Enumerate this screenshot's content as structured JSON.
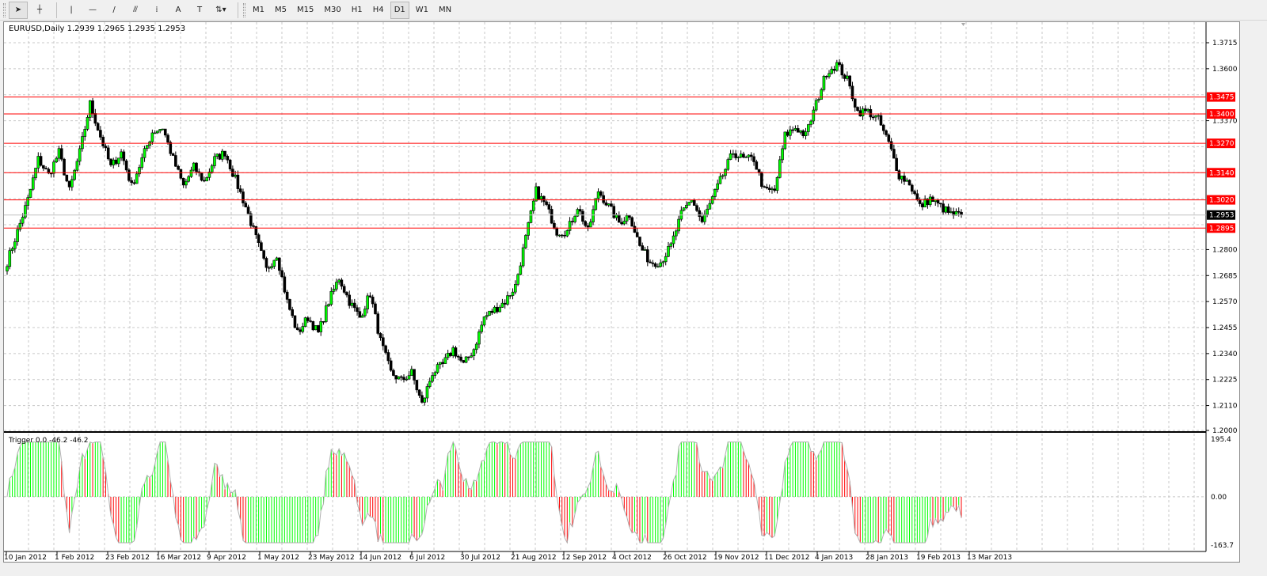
{
  "toolbar": {
    "tools": [
      {
        "name": "cursor-icon",
        "glyph": "➤"
      },
      {
        "name": "crosshair-icon",
        "glyph": "┼"
      },
      {
        "name": "vertical-line-icon",
        "glyph": "|"
      },
      {
        "name": "horizontal-line-icon",
        "glyph": "—"
      },
      {
        "name": "trendline-icon",
        "glyph": "/"
      },
      {
        "name": "fibonacci-icon",
        "glyph": "⫻"
      },
      {
        "name": "fibo-fan-icon",
        "glyph": "⁞"
      },
      {
        "name": "text-icon",
        "glyph": "A"
      },
      {
        "name": "text-label-icon",
        "glyph": "T"
      },
      {
        "name": "arrows-icon",
        "glyph": "⇅▾"
      }
    ],
    "timeframes": [
      "M1",
      "M5",
      "M15",
      "M30",
      "H1",
      "H4",
      "D1",
      "W1",
      "MN"
    ],
    "active_timeframe": "D1"
  },
  "chart": {
    "title": "EURUSD,Daily  1.2939 1.2965 1.2935 1.2953",
    "price_labels": [
      "1.3715",
      "1.3600",
      "1.3370",
      "1.2800",
      "1.2685",
      "1.2570",
      "1.2455",
      "1.2340",
      "1.2225",
      "1.2110",
      "1.2000"
    ],
    "grid_prices": [
      1.3715,
      1.36,
      1.3485,
      1.337,
      1.3255,
      1.314,
      1.3025,
      1.291,
      1.28,
      1.2685,
      1.257,
      1.2455,
      1.234,
      1.2225,
      1.211,
      1.2
    ],
    "levels": [
      {
        "price": 1.3475,
        "label": "1.3475"
      },
      {
        "price": 1.34,
        "label": "1.3400"
      },
      {
        "price": 1.327,
        "label": "1.3270"
      },
      {
        "price": 1.314,
        "label": "1.3140"
      },
      {
        "price": 1.302,
        "label": "1.3020"
      },
      {
        "price": 1.2895,
        "label": "1.2895"
      }
    ],
    "current": {
      "price": 1.2953,
      "label": "1.2953"
    },
    "price_range": [
      1.2,
      1.3715
    ],
    "level_color": "#ff0000",
    "bull_color": "#00ff00",
    "bear_color": "#000000",
    "closes": [
      1.2745,
      1.288,
      1.302,
      1.32,
      1.313,
      1.323,
      1.306,
      1.323,
      1.3445,
      1.33,
      1.3165,
      1.323,
      1.308,
      1.32,
      1.332,
      1.334,
      1.32,
      1.308,
      1.3165,
      1.31,
      1.32,
      1.323,
      1.311,
      1.299,
      1.285,
      1.271,
      1.278,
      1.257,
      1.243,
      1.25,
      1.243,
      1.257,
      1.2675,
      1.257,
      1.25,
      1.2605,
      1.2395,
      1.2255,
      1.222,
      1.2255,
      1.2115,
      1.2255,
      1.229,
      1.236,
      1.229,
      1.236,
      1.25,
      1.2535,
      1.257,
      1.264,
      1.285,
      1.306,
      1.299,
      1.288,
      1.288,
      1.299,
      1.288,
      1.306,
      1.299,
      1.292,
      1.2955,
      1.2815,
      1.2745,
      1.2745,
      1.2815,
      1.2955,
      1.3025,
      1.292,
      1.3025,
      1.313,
      1.323,
      1.32,
      1.32,
      1.306,
      1.306,
      1.3305,
      1.334,
      1.3305,
      1.3445,
      1.3585,
      1.362,
      1.355,
      1.341,
      1.341,
      1.3375,
      1.327,
      1.313,
      1.3095,
      1.299,
      1.3025,
      1.299,
      1.2955,
      1.2953
    ],
    "dates": [
      "10 Jan 2012",
      "1 Feb 2012",
      "23 Feb 2012",
      "16 Mar 2012",
      "9 Apr 2012",
      "1 May 2012",
      "23 May 2012",
      "14 Jun 2012",
      "6 Jul 2012",
      "30 Jul 2012",
      "21 Aug 2012",
      "12 Sep 2012",
      "4 Oct 2012",
      "26 Oct 2012",
      "19 Nov 2012",
      "11 Dec 2012",
      "4 Jan 2013",
      "28 Jan 2013",
      "19 Feb 2013",
      "13 Mar 2013"
    ]
  },
  "indicator": {
    "title": "Trigger 0.0 -46.2 -46.2",
    "max_label": "195.4",
    "zero_label": "0.00",
    "min_label": "-163.7",
    "range": [
      -163.7,
      195.4
    ],
    "up_color": "#00ff00",
    "down_color": "#ff0000"
  }
}
